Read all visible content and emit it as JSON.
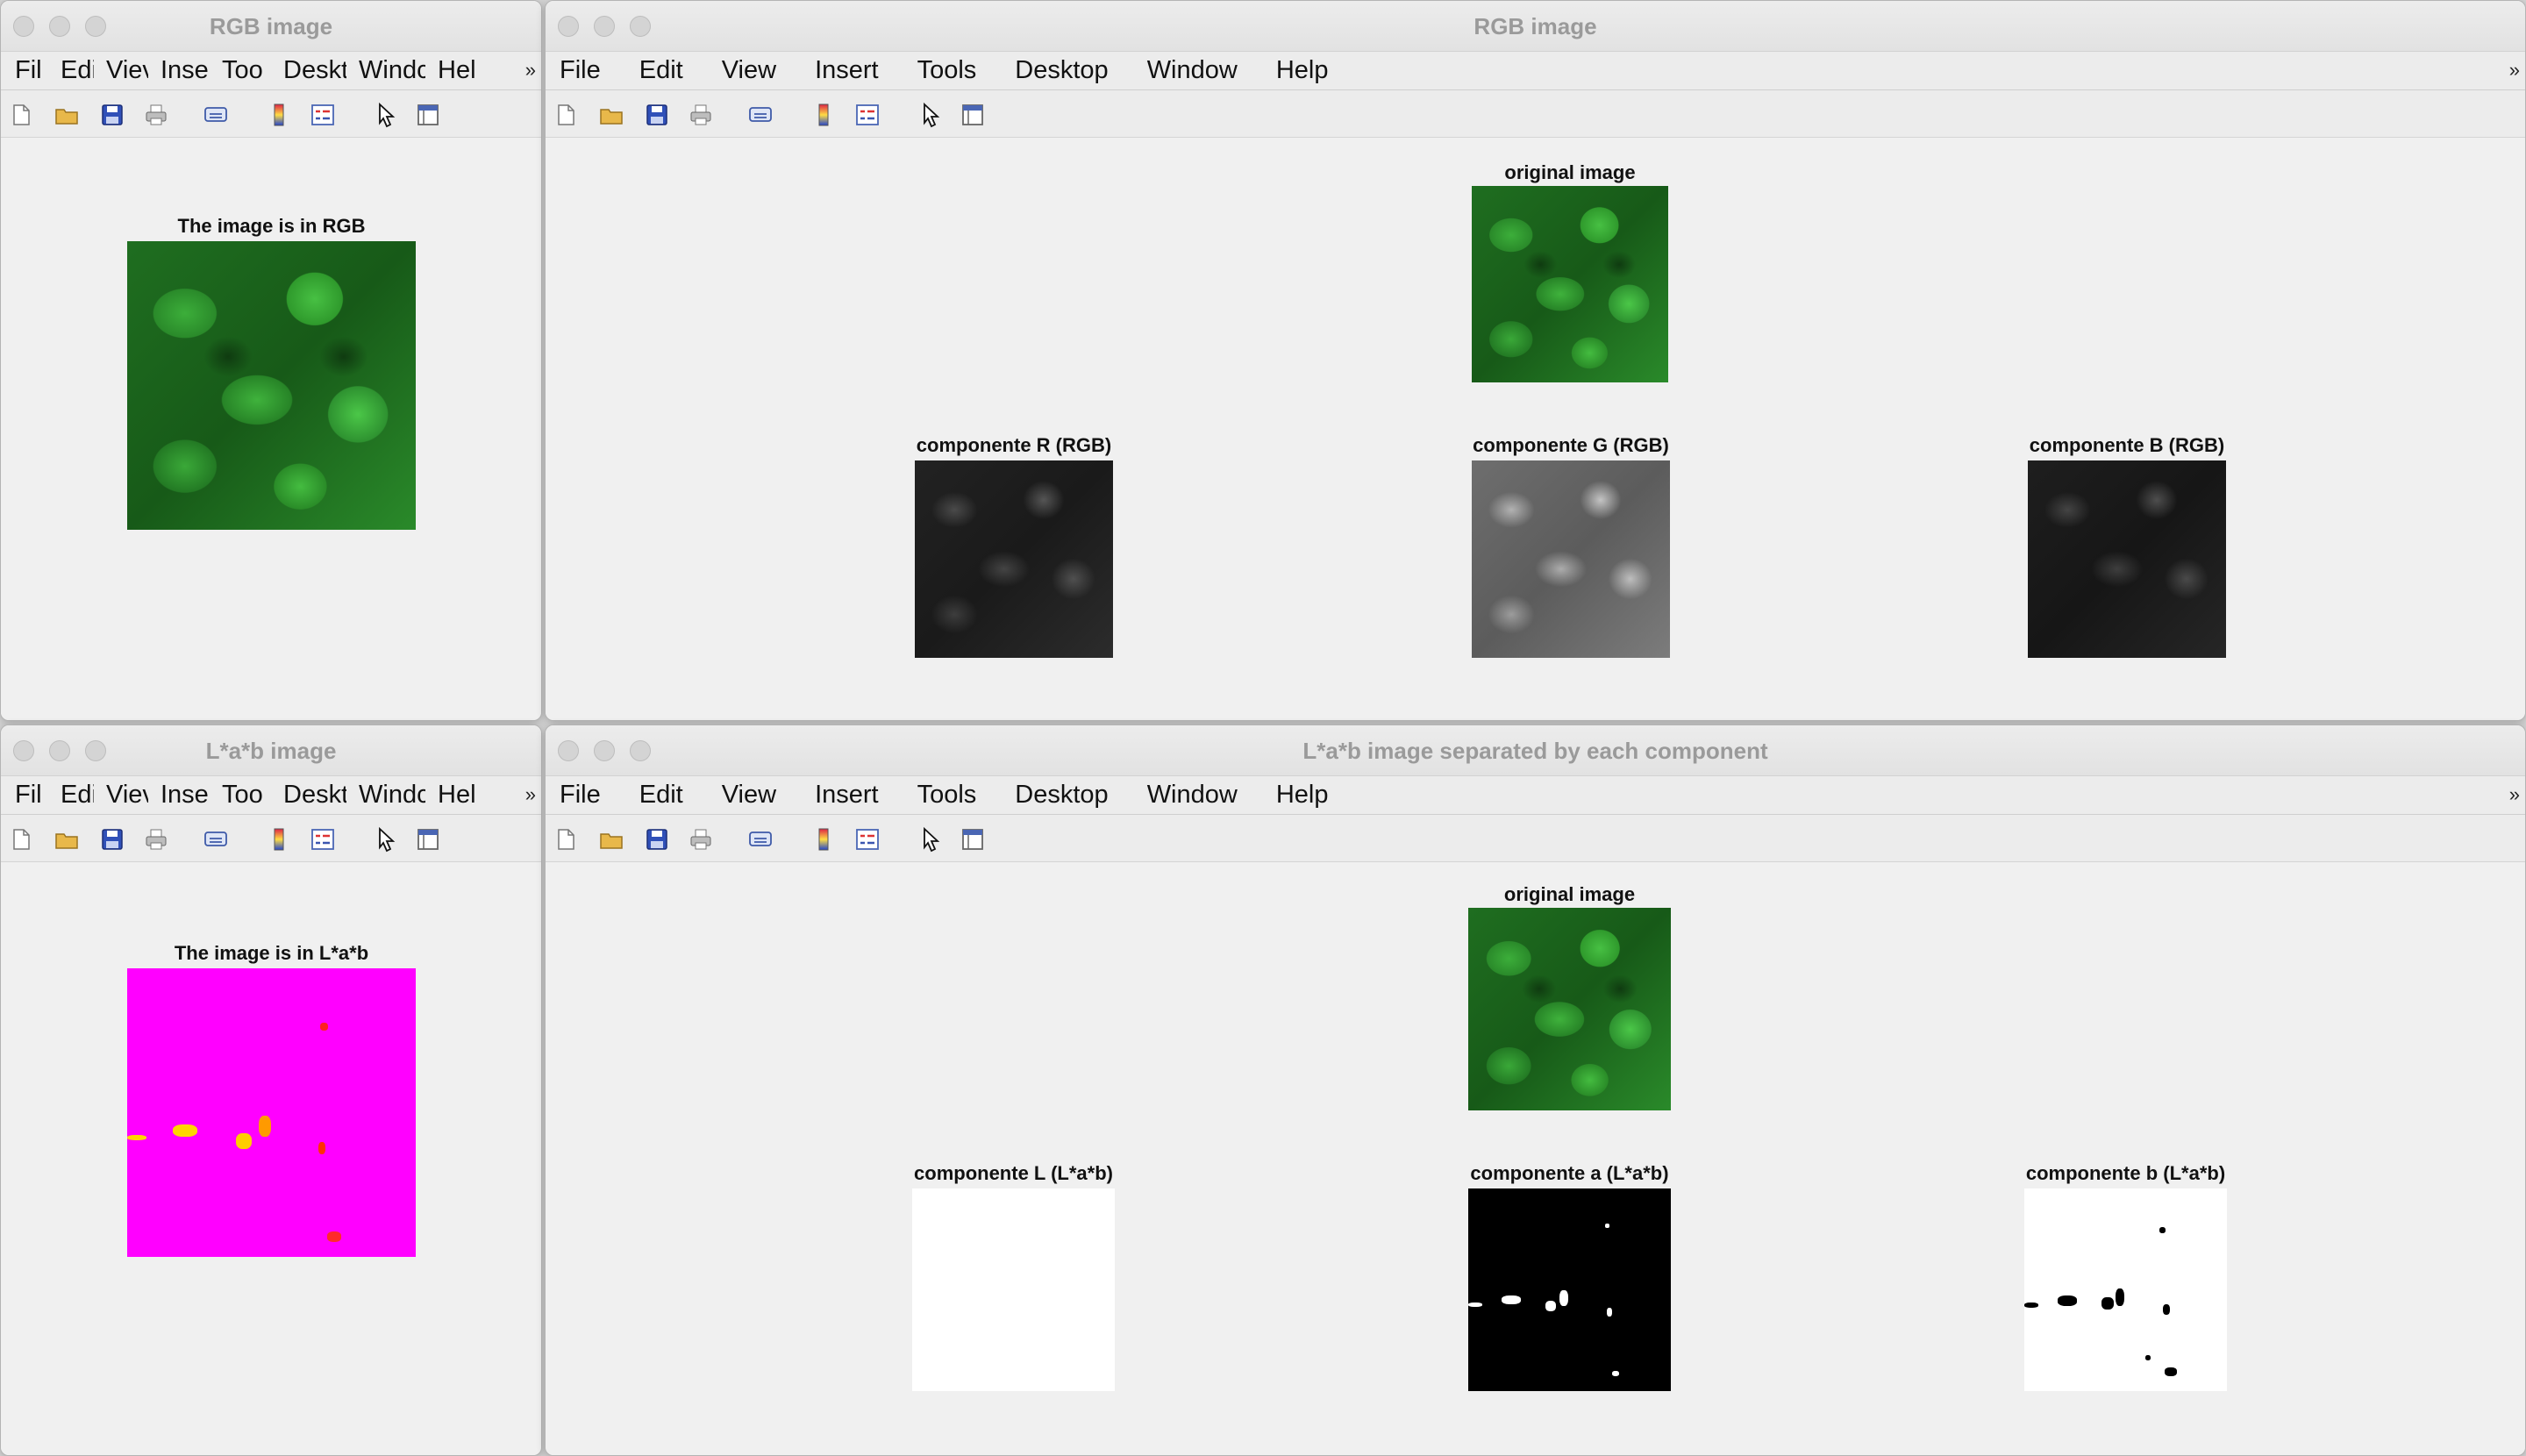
{
  "windows": {
    "rgb_small": {
      "title": "RGB image",
      "axis_title": "The image is in RGB"
    },
    "rgb_big": {
      "title": "RGB image",
      "axes": [
        {
          "title": "original image"
        },
        {
          "title": "componente R (RGB)"
        },
        {
          "title": "componente G (RGB)"
        },
        {
          "title": "componente B (RGB)"
        }
      ]
    },
    "lab_small": {
      "title": "L*a*b image",
      "axis_title": "The image is in L*a*b"
    },
    "lab_big": {
      "title": "L*a*b image separated by each component",
      "axes": [
        {
          "title": "original image"
        },
        {
          "title": "componente L (L*a*b)"
        },
        {
          "title": "componente a (L*a*b)"
        },
        {
          "title": "componente b (L*a*b)"
        }
      ]
    }
  },
  "menu_narrow": [
    "Fil",
    "Edi",
    "Viev",
    "Inse",
    "Too",
    "Deskt",
    "Windc",
    "Hel"
  ],
  "menu_wide": [
    "File",
    "Edit",
    "View",
    "Insert",
    "Tools",
    "Desktop",
    "Window",
    "Help"
  ],
  "menu_overflow_glyph": "»",
  "toolbar_icons": [
    "new-figure-icon",
    "open-icon",
    "save-icon",
    "print-icon",
    "link-icon",
    "colorbar-icon",
    "legend-icon",
    "pointer-icon",
    "dock-icon"
  ],
  "colors": {
    "lab_false_color": "#ff00ff",
    "traffic_inactive": "#d4d4d4"
  }
}
